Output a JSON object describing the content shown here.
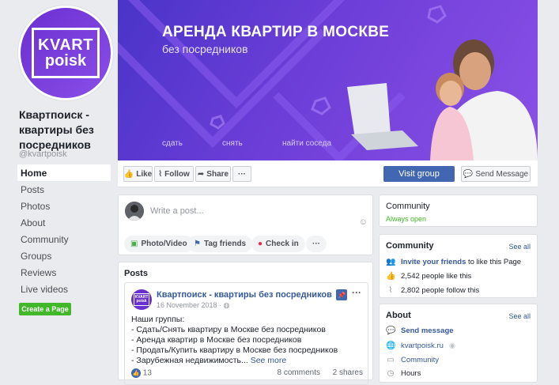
{
  "profile": {
    "logo_line1": "KVART",
    "logo_line2": "poisk",
    "page_name": "Квартпоиск - квартиры без посредников",
    "handle": "@kvartpoisk"
  },
  "left_nav": {
    "items": [
      "Home",
      "Posts",
      "Photos",
      "About",
      "Community",
      "Groups",
      "Reviews",
      "Live videos"
    ],
    "create_page": "Create a Page"
  },
  "cover": {
    "title": "АРЕНДА КВАРТИР В МОСКВЕ",
    "subtitle": "без посредников",
    "links": [
      "сдать",
      "снять",
      "найти соседа"
    ]
  },
  "actions": {
    "like": "Like",
    "follow": "Follow",
    "share": "Share",
    "more": "···",
    "visit_group": "Visit group",
    "send_message": "Send Message"
  },
  "composer": {
    "placeholder": "Write a post...",
    "photo_video": "Photo/Video",
    "tag_friends": "Tag friends",
    "check_in": "Check in",
    "more": "···"
  },
  "posts": {
    "header": "Posts",
    "post": {
      "author": "Квартпоиск - квартиры без посредников",
      "date": "16 November 2018 · ",
      "lines": [
        "Наши группы:",
        "- Сдать/Снять квартиру в Москве без посредников",
        "- Аренда квартир в Москве без посредников",
        "- Продать/Купить квартиру в Москве без посредников",
        "- Зарубежная недвижимость..."
      ],
      "see_more": "See more",
      "likes": "13",
      "comments": "8 comments",
      "shares": "2 shares"
    }
  },
  "right": {
    "community_card": {
      "title": "Community",
      "status": "Always open"
    },
    "community": {
      "title": "Community",
      "see_all": "See all",
      "invite_link": "Invite your friends",
      "invite_rest": " to like this Page",
      "likes": "2,542 people like this",
      "follows": "2,802 people follow this"
    },
    "about": {
      "title": "About",
      "see_all": "See all",
      "send_message": "Send message",
      "website": "kvartpoisk.ru",
      "category": "Community",
      "hours": "Hours"
    }
  },
  "colors": {
    "brand": "#4267b2",
    "cover_purple": "#6d3ed8",
    "green": "#42b72a"
  }
}
